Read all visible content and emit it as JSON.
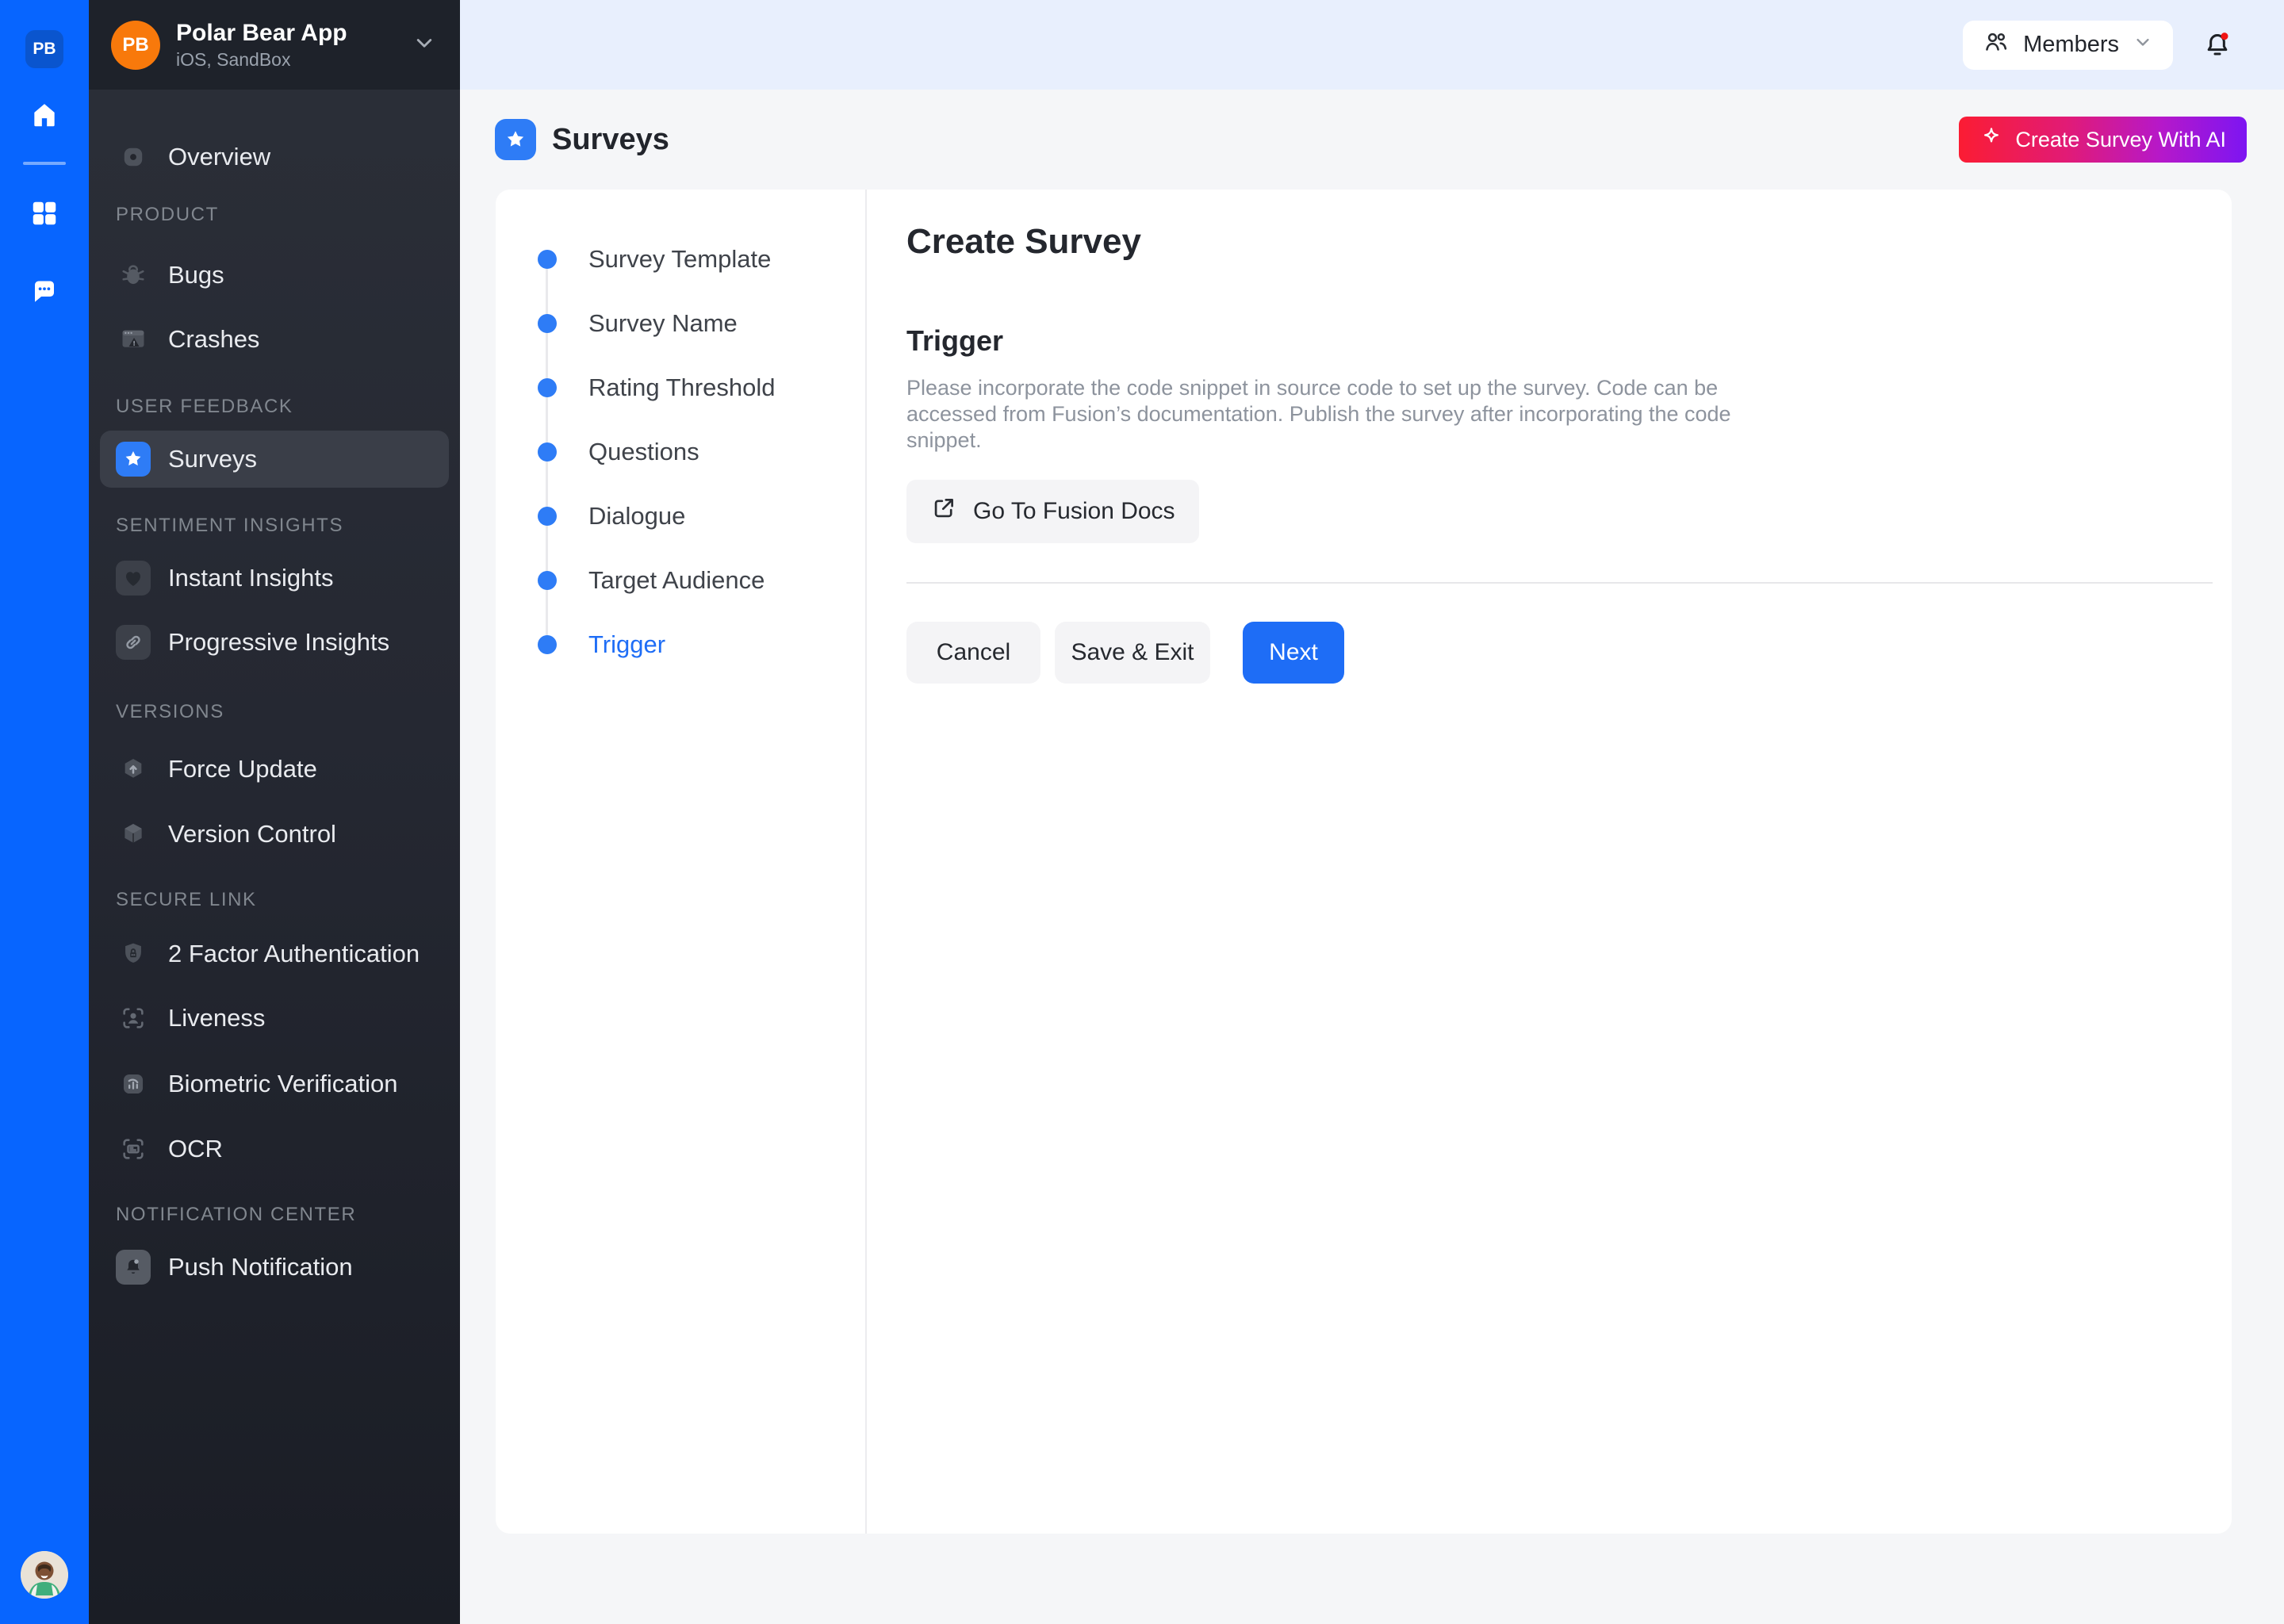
{
  "rail": {
    "logo": "PB"
  },
  "workspace": {
    "avatar_initials": "PB",
    "name": "Polar Bear App",
    "platform": "iOS, SandBox"
  },
  "sidebar": {
    "overview": {
      "label": "Overview"
    },
    "sections": [
      {
        "label": "PRODUCT",
        "items": [
          {
            "label": "Bugs"
          },
          {
            "label": "Crashes"
          }
        ]
      },
      {
        "label": "USER FEEDBACK",
        "items": [
          {
            "label": "Surveys",
            "selected": true
          }
        ]
      },
      {
        "label": "SENTIMENT INSIGHTS",
        "items": [
          {
            "label": "Instant Insights"
          },
          {
            "label": "Progressive Insights"
          }
        ]
      },
      {
        "label": "VERSIONS",
        "items": [
          {
            "label": "Force Update"
          },
          {
            "label": "Version Control"
          }
        ]
      },
      {
        "label": "SECURE LINK",
        "items": [
          {
            "label": "2 Factor Authentication"
          },
          {
            "label": "Liveness"
          },
          {
            "label": "Biometric Verification"
          },
          {
            "label": "OCR"
          }
        ]
      },
      {
        "label": "NOTIFICATION CENTER",
        "items": [
          {
            "label": "Push Notification"
          }
        ]
      }
    ]
  },
  "topbar": {
    "members": "Members",
    "notification_badge": true
  },
  "page": {
    "title": "Surveys",
    "create_with_ai": "Create Survey With AI"
  },
  "stepper": {
    "steps": [
      {
        "label": "Survey Template"
      },
      {
        "label": "Survey Name"
      },
      {
        "label": "Rating Threshold"
      },
      {
        "label": "Questions"
      },
      {
        "label": "Dialogue"
      },
      {
        "label": "Target Audience"
      },
      {
        "label": "Trigger",
        "active": true
      }
    ]
  },
  "form": {
    "title": "Create Survey",
    "section": "Trigger",
    "description": "Please incorporate the code snippet in source code to set up the survey. Code can be accessed from Fusion’s documentation. Publish the survey after incorporating the code snippet.",
    "docs_button": "Go To Fusion Docs",
    "cancel": "Cancel",
    "save_exit": "Save & Exit",
    "next": "Next"
  },
  "colors": {
    "rail_blue": "#0765ff",
    "accent_blue": "#2e7cf6",
    "next_blue": "#1e6df6",
    "notification_dot": "#f01414",
    "ai_gradient_start": "#fb1c33",
    "ai_gradient_end": "#7d15f2",
    "sidebar_top": "#2b2f38",
    "sidebar_bottom": "#1a1d25",
    "topbar_bg": "#e8effd"
  }
}
